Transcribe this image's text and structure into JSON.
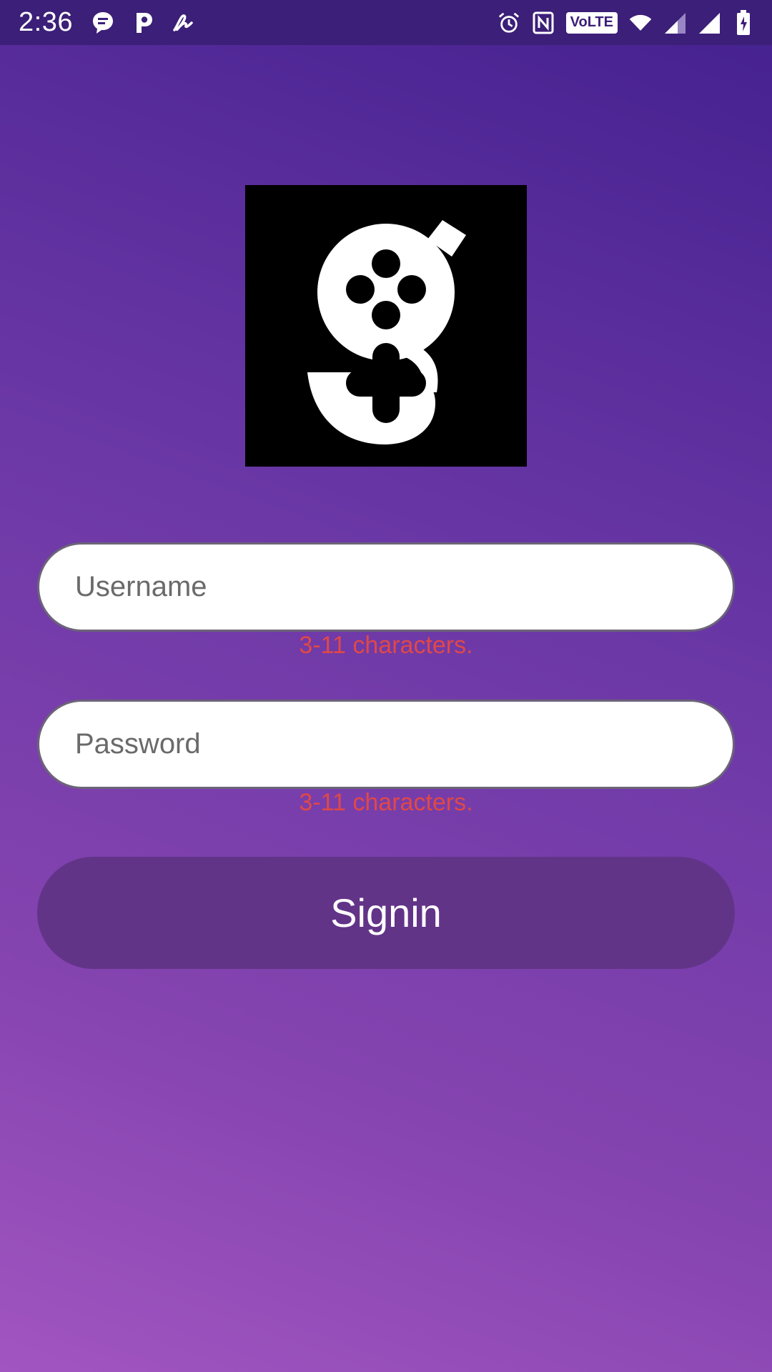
{
  "status_bar": {
    "time": "2:36",
    "left_icons": [
      "chat-bubble-icon",
      "parking-icon",
      "signature-icon"
    ],
    "right_icons": [
      "alarm-icon",
      "nfc-icon",
      "volte-icon",
      "wifi-icon",
      "signal-icon",
      "signal-icon",
      "battery-charging-icon"
    ],
    "volte_label": "VoLTE"
  },
  "logo": {
    "icon": "gamepad-g-logo",
    "bg_color": "#000000",
    "fg_color": "#ffffff"
  },
  "form": {
    "username": {
      "placeholder": "Username",
      "value": "",
      "error": "3-11 characters."
    },
    "password": {
      "placeholder": "Password",
      "value": "",
      "error": "3-11 characters."
    },
    "submit_label": "Signin"
  },
  "colors": {
    "error": "#e04848",
    "button": "#623488",
    "status_bar": "#3c1f78"
  }
}
